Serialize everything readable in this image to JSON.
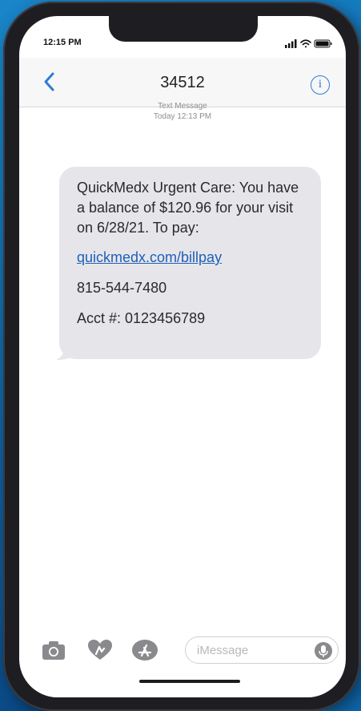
{
  "status_bar": {
    "time": "12:15 PM",
    "icons": [
      "signal-icon",
      "wifi-icon",
      "battery-icon"
    ]
  },
  "header": {
    "contact": "34512",
    "back_icon": "chevron-left-icon",
    "info_label": "i"
  },
  "thread_meta": {
    "service": "Text Message",
    "timestamp": "Today 12:13 PM"
  },
  "message": {
    "body": "QuickMedx Urgent Care: You have a balance of $120.96 for your visit on 6/28/21. To pay:",
    "link": "quickmedx.com/billpay",
    "phone": "815-544-7480",
    "account": "Acct #: 0123456789"
  },
  "compose": {
    "placeholder": "iMessage",
    "icons": [
      "camera-icon",
      "digital-touch-icon",
      "app-store-icon",
      "mic-icon"
    ]
  },
  "colors": {
    "accent": "#2e7bd6",
    "bubble": "#e6e6ea",
    "link": "#1f5fb8",
    "background": "#0d67ad"
  }
}
